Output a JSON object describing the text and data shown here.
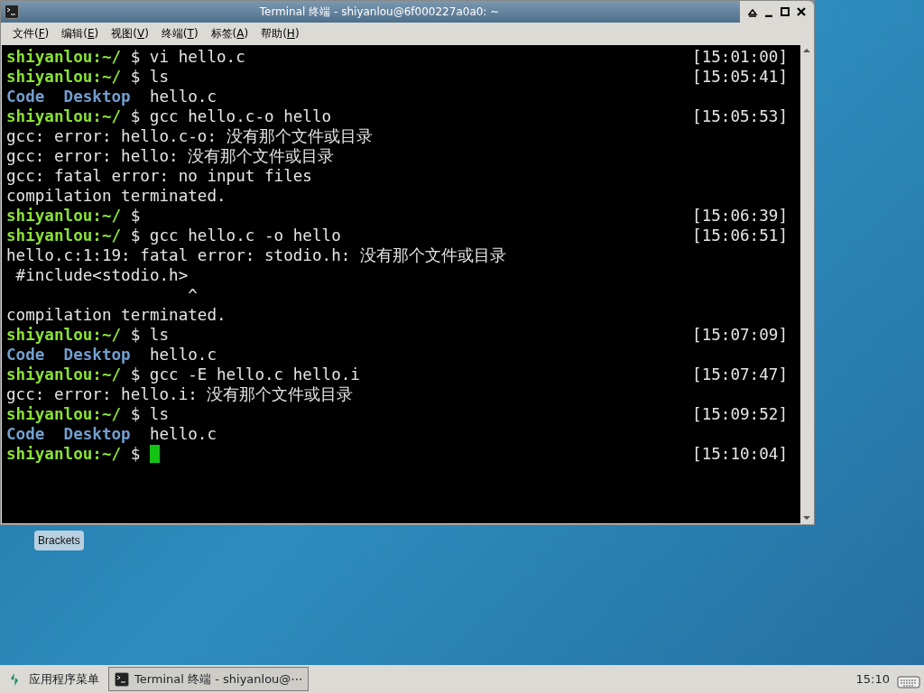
{
  "window": {
    "title": "Terminal 终端 - shiyanlou@6f000227a0a0: ~"
  },
  "menu": [
    {
      "before": "文件(",
      "mnemonic": "F",
      "after": ")"
    },
    {
      "before": "编辑(",
      "mnemonic": "E",
      "after": ")"
    },
    {
      "before": "视图(",
      "mnemonic": "V",
      "after": ")"
    },
    {
      "before": "终端(",
      "mnemonic": "T",
      "after": ")"
    },
    {
      "before": "标签(",
      "mnemonic": "A",
      "after": ")"
    },
    {
      "before": "帮助(",
      "mnemonic": "H",
      "after": ")"
    }
  ],
  "terminal": {
    "lines": [
      {
        "kind": "prompt",
        "prompt": "shiyanlou:~/",
        "command": "$ vi hello.c",
        "time": "[15:01:00]"
      },
      {
        "kind": "prompt",
        "prompt": "shiyanlou:~/",
        "command": "$ ls",
        "time": "[15:05:41]"
      },
      {
        "kind": "listing",
        "items": [
          {
            "text": "Code",
            "kind": "dir"
          },
          {
            "text": "Desktop",
            "kind": "dir"
          },
          {
            "text": "hello.c",
            "kind": "file"
          }
        ]
      },
      {
        "kind": "prompt",
        "prompt": "shiyanlou:~/",
        "command": "$ gcc hello.c-o hello",
        "time": "[15:05:53]"
      },
      {
        "kind": "output",
        "text": "gcc: error: hello.c-o: 没有那个文件或目录"
      },
      {
        "kind": "output",
        "text": "gcc: error: hello: 没有那个文件或目录"
      },
      {
        "kind": "output",
        "text": "gcc: fatal error: no input files"
      },
      {
        "kind": "output",
        "text": "compilation terminated."
      },
      {
        "kind": "prompt",
        "prompt": "shiyanlou:~/",
        "command": "$",
        "time": "[15:06:39]"
      },
      {
        "kind": "prompt",
        "prompt": "shiyanlou:~/",
        "command": "$ gcc hello.c -o hello",
        "time": "[15:06:51]"
      },
      {
        "kind": "output",
        "text": "hello.c:1:19: fatal error: stodio.h: 没有那个文件或目录"
      },
      {
        "kind": "output",
        "text": " #include<stodio.h>"
      },
      {
        "kind": "output",
        "text": "                   ^"
      },
      {
        "kind": "output",
        "text": "compilation terminated."
      },
      {
        "kind": "prompt",
        "prompt": "shiyanlou:~/",
        "command": "$ ls",
        "time": "[15:07:09]"
      },
      {
        "kind": "listing",
        "items": [
          {
            "text": "Code",
            "kind": "dir"
          },
          {
            "text": "Desktop",
            "kind": "dir"
          },
          {
            "text": "hello.c",
            "kind": "file"
          }
        ]
      },
      {
        "kind": "prompt",
        "prompt": "shiyanlou:~/",
        "command": "$ gcc -E hello.c hello.i",
        "time": "[15:07:47]"
      },
      {
        "kind": "output",
        "text": "gcc: error: hello.i: 没有那个文件或目录"
      },
      {
        "kind": "prompt",
        "prompt": "shiyanlou:~/",
        "command": "$ ls",
        "time": "[15:09:52]"
      },
      {
        "kind": "listing",
        "items": [
          {
            "text": "Code",
            "kind": "dir"
          },
          {
            "text": "Desktop",
            "kind": "dir"
          },
          {
            "text": "hello.c",
            "kind": "file"
          }
        ]
      },
      {
        "kind": "prompt",
        "prompt": "shiyanlou:~/",
        "command": "$",
        "time": "[15:10:04]",
        "cursor": true
      }
    ]
  },
  "desktop": {
    "icons": [
      {
        "label": "Brackets"
      }
    ]
  },
  "taskbar": {
    "start": "应用程序菜单",
    "tasks": [
      {
        "label": "Terminal 终端 - shiyanlou@⋯",
        "selected": true
      }
    ],
    "clock": "15:10"
  }
}
